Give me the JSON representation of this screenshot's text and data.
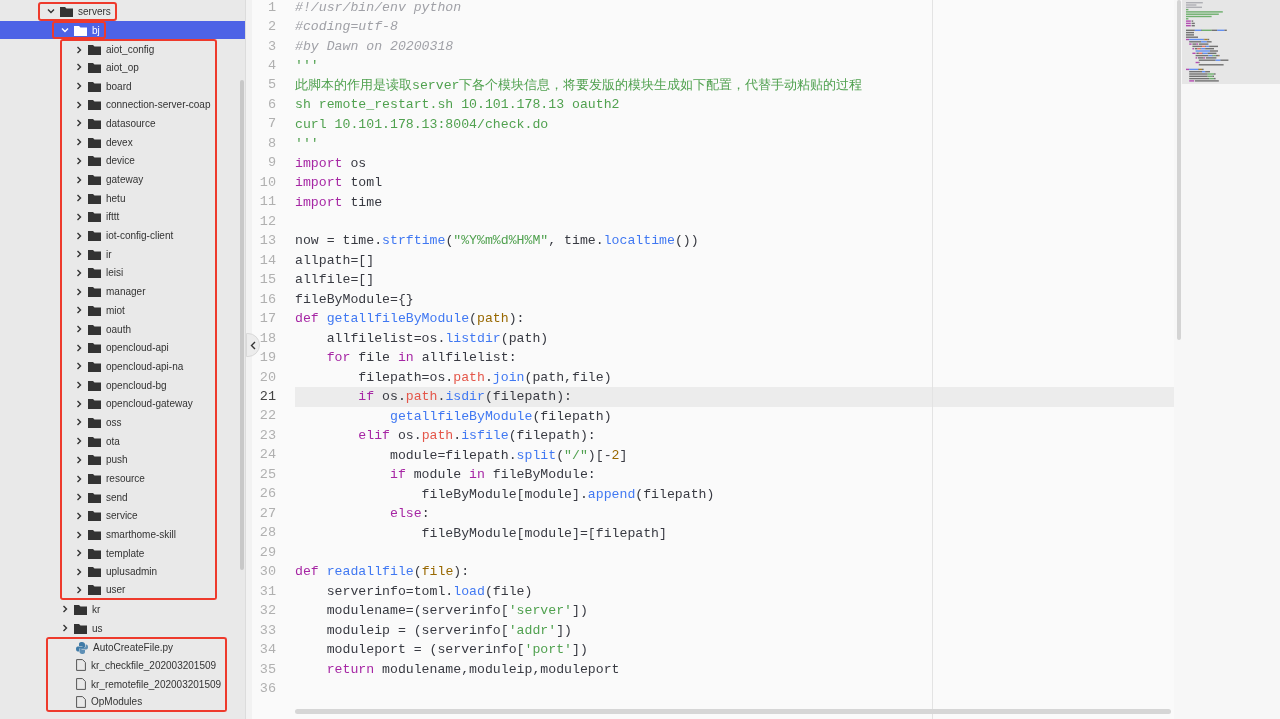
{
  "tree": [
    {
      "name": "servers",
      "kind": "folder",
      "expanded": true,
      "selected": false,
      "annotated": true,
      "children": [
        {
          "name": "bj",
          "kind": "folder",
          "expanded": true,
          "selected": true,
          "annotated": true,
          "children": [
            {
              "name": "aiot_config",
              "kind": "folder",
              "expanded": false,
              "selected": false,
              "annotated": true
            },
            {
              "name": "aiot_op",
              "kind": "folder",
              "expanded": false,
              "selected": false,
              "annotated": true
            },
            {
              "name": "board",
              "kind": "folder",
              "expanded": false,
              "selected": false,
              "annotated": true
            },
            {
              "name": "connection-server-coap",
              "kind": "folder",
              "expanded": false,
              "selected": false,
              "annotated": true
            },
            {
              "name": "datasource",
              "kind": "folder",
              "expanded": false,
              "selected": false,
              "annotated": true
            },
            {
              "name": "devex",
              "kind": "folder",
              "expanded": false,
              "selected": false,
              "annotated": true
            },
            {
              "name": "device",
              "kind": "folder",
              "expanded": false,
              "selected": false,
              "annotated": true
            },
            {
              "name": "gateway",
              "kind": "folder",
              "expanded": false,
              "selected": false,
              "annotated": true
            },
            {
              "name": "hetu",
              "kind": "folder",
              "expanded": false,
              "selected": false,
              "annotated": true
            },
            {
              "name": "ifttt",
              "kind": "folder",
              "expanded": false,
              "selected": false,
              "annotated": true
            },
            {
              "name": "iot-config-client",
              "kind": "folder",
              "expanded": false,
              "selected": false,
              "annotated": true
            },
            {
              "name": "ir",
              "kind": "folder",
              "expanded": false,
              "selected": false,
              "annotated": true
            },
            {
              "name": "leisi",
              "kind": "folder",
              "expanded": false,
              "selected": false,
              "annotated": true
            },
            {
              "name": "manager",
              "kind": "folder",
              "expanded": false,
              "selected": false,
              "annotated": true
            },
            {
              "name": "miot",
              "kind": "folder",
              "expanded": false,
              "selected": false,
              "annotated": true
            },
            {
              "name": "oauth",
              "kind": "folder",
              "expanded": false,
              "selected": false,
              "annotated": true
            },
            {
              "name": "opencloud-api",
              "kind": "folder",
              "expanded": false,
              "selected": false,
              "annotated": true
            },
            {
              "name": "opencloud-api-na",
              "kind": "folder",
              "expanded": false,
              "selected": false,
              "annotated": true
            },
            {
              "name": "opencloud-bg",
              "kind": "folder",
              "expanded": false,
              "selected": false,
              "annotated": true
            },
            {
              "name": "opencloud-gateway",
              "kind": "folder",
              "expanded": false,
              "selected": false,
              "annotated": true
            },
            {
              "name": "oss",
              "kind": "folder",
              "expanded": false,
              "selected": false,
              "annotated": true
            },
            {
              "name": "ota",
              "kind": "folder",
              "expanded": false,
              "selected": false,
              "annotated": true
            },
            {
              "name": "push",
              "kind": "folder",
              "expanded": false,
              "selected": false,
              "annotated": true
            },
            {
              "name": "resource",
              "kind": "folder",
              "expanded": false,
              "selected": false,
              "annotated": true
            },
            {
              "name": "send",
              "kind": "folder",
              "expanded": false,
              "selected": false,
              "annotated": true
            },
            {
              "name": "service",
              "kind": "folder",
              "expanded": false,
              "selected": false,
              "annotated": true
            },
            {
              "name": "smarthome-skill",
              "kind": "folder",
              "expanded": false,
              "selected": false,
              "annotated": true
            },
            {
              "name": "template",
              "kind": "folder",
              "expanded": false,
              "selected": false,
              "annotated": true
            },
            {
              "name": "uplusadmin",
              "kind": "folder",
              "expanded": false,
              "selected": false,
              "annotated": true
            },
            {
              "name": "user",
              "kind": "folder",
              "expanded": false,
              "selected": false,
              "annotated": true
            }
          ]
        },
        {
          "name": "kr",
          "kind": "folder",
          "expanded": false,
          "selected": false,
          "annotated": false
        },
        {
          "name": "us",
          "kind": "folder",
          "expanded": false,
          "selected": false,
          "annotated": false
        },
        {
          "name": "AutoCreateFile.py",
          "kind": "python",
          "selected": false,
          "annotated": true
        },
        {
          "name": "kr_checkfile_202003201509",
          "kind": "file",
          "selected": false,
          "annotated": true
        },
        {
          "name": "kr_remotefile_202003201509",
          "kind": "file",
          "selected": false,
          "annotated": true
        },
        {
          "name": "OpModules",
          "kind": "file",
          "selected": false,
          "annotated": true
        }
      ]
    }
  ],
  "code": [
    {
      "number": "1",
      "current": false,
      "tokens": [
        {
          "kind": "comment",
          "text": "#!/usr/bin/env python"
        }
      ]
    },
    {
      "number": "2",
      "current": false,
      "tokens": [
        {
          "kind": "comment",
          "text": "#coding=utf-8"
        }
      ]
    },
    {
      "number": "3",
      "current": false,
      "tokens": [
        {
          "kind": "comment",
          "text": "#by Dawn on 20200318"
        }
      ]
    },
    {
      "number": "4",
      "current": false,
      "tokens": [
        {
          "kind": "string",
          "text": "'''"
        }
      ]
    },
    {
      "number": "5",
      "current": false,
      "tokens": [
        {
          "kind": "string",
          "text": "此脚本的作用是读取server下各个模块信息，将要发版的模块生成如下配置，代替手动粘贴的过程"
        }
      ]
    },
    {
      "number": "6",
      "current": false,
      "tokens": [
        {
          "kind": "string",
          "text": "sh remote_restart.sh 10.101.178.13 oauth2"
        }
      ]
    },
    {
      "number": "7",
      "current": false,
      "tokens": [
        {
          "kind": "string",
          "text": "curl 10.101.178.13:8004/check.do"
        }
      ]
    },
    {
      "number": "8",
      "current": false,
      "tokens": [
        {
          "kind": "string",
          "text": "'''"
        }
      ]
    },
    {
      "number": "9",
      "current": false,
      "tokens": [
        {
          "kind": "keyword",
          "text": "import"
        },
        {
          "kind": "plain",
          "text": " os"
        }
      ]
    },
    {
      "number": "10",
      "current": false,
      "tokens": [
        {
          "kind": "keyword",
          "text": "import"
        },
        {
          "kind": "plain",
          "text": " toml"
        }
      ]
    },
    {
      "number": "11",
      "current": false,
      "tokens": [
        {
          "kind": "keyword",
          "text": "import"
        },
        {
          "kind": "plain",
          "text": " time"
        }
      ]
    },
    {
      "number": "12",
      "current": false
    },
    {
      "number": "13",
      "current": false,
      "tokens": [
        {
          "kind": "plain",
          "text": "now = time."
        },
        {
          "kind": "function",
          "text": "strftime"
        },
        {
          "kind": "plain",
          "text": "("
        },
        {
          "kind": "string",
          "text": "\"%Y%m%d%H%M\""
        },
        {
          "kind": "plain",
          "text": ", time."
        },
        {
          "kind": "function",
          "text": "localtime"
        },
        {
          "kind": "plain",
          "text": "())"
        }
      ]
    },
    {
      "number": "14",
      "current": false,
      "tokens": [
        {
          "kind": "plain",
          "text": "allpath=[]"
        }
      ]
    },
    {
      "number": "15",
      "current": false,
      "tokens": [
        {
          "kind": "plain",
          "text": "allfile=[]"
        }
      ]
    },
    {
      "number": "16",
      "current": false,
      "tokens": [
        {
          "kind": "plain",
          "text": "fileByModule={}"
        }
      ]
    },
    {
      "number": "17",
      "current": false,
      "tokens": [
        {
          "kind": "keyword",
          "text": "def "
        },
        {
          "kind": "function",
          "text": "getallfileByModule"
        },
        {
          "kind": "plain",
          "text": "("
        },
        {
          "kind": "param",
          "text": "path"
        },
        {
          "kind": "plain",
          "text": "):"
        }
      ]
    },
    {
      "number": "18",
      "current": false,
      "tokens": [
        {
          "kind": "plain",
          "text": "    allfilelist=os."
        },
        {
          "kind": "function",
          "text": "listdir"
        },
        {
          "kind": "plain",
          "text": "(path)"
        }
      ]
    },
    {
      "number": "19",
      "current": false,
      "tokens": [
        {
          "kind": "keyword",
          "text": "    for"
        },
        {
          "kind": "plain",
          "text": " file "
        },
        {
          "kind": "keyword",
          "text": "in"
        },
        {
          "kind": "plain",
          "text": " allfilelist:"
        }
      ]
    },
    {
      "number": "20",
      "current": false,
      "tokens": [
        {
          "kind": "plain",
          "text": "        filepath=os."
        },
        {
          "kind": "attribute",
          "text": "path"
        },
        {
          "kind": "plain",
          "text": "."
        },
        {
          "kind": "function",
          "text": "join"
        },
        {
          "kind": "plain",
          "text": "(path,file)"
        }
      ]
    },
    {
      "number": "21",
      "current": true,
      "tokens": [
        {
          "kind": "keyword",
          "text": "        if"
        },
        {
          "kind": "plain",
          "text": " os."
        },
        {
          "kind": "attribute",
          "text": "path"
        },
        {
          "kind": "plain",
          "text": "."
        },
        {
          "kind": "function",
          "text": "isdir"
        },
        {
          "kind": "plain",
          "text": "(filepath):"
        }
      ]
    },
    {
      "number": "22",
      "current": false,
      "tokens": [
        {
          "kind": "function",
          "text": "            getallfileByModule"
        },
        {
          "kind": "plain",
          "text": "(filepath)"
        }
      ]
    },
    {
      "number": "23",
      "current": false,
      "tokens": [
        {
          "kind": "keyword",
          "text": "        elif"
        },
        {
          "kind": "plain",
          "text": " os."
        },
        {
          "kind": "attribute",
          "text": "path"
        },
        {
          "kind": "plain",
          "text": "."
        },
        {
          "kind": "function",
          "text": "isfile"
        },
        {
          "kind": "plain",
          "text": "(filepath):"
        }
      ]
    },
    {
      "number": "24",
      "current": false,
      "tokens": [
        {
          "kind": "plain",
          "text": "            module=filepath."
        },
        {
          "kind": "function",
          "text": "split"
        },
        {
          "kind": "plain",
          "text": "("
        },
        {
          "kind": "string",
          "text": "\"/\""
        },
        {
          "kind": "plain",
          "text": ")[-"
        },
        {
          "kind": "number",
          "text": "2"
        },
        {
          "kind": "plain",
          "text": "]"
        }
      ]
    },
    {
      "number": "25",
      "current": false,
      "tokens": [
        {
          "kind": "keyword",
          "text": "            if"
        },
        {
          "kind": "plain",
          "text": " module "
        },
        {
          "kind": "keyword",
          "text": "in"
        },
        {
          "kind": "plain",
          "text": " fileByModule:"
        }
      ]
    },
    {
      "number": "26",
      "current": false,
      "tokens": [
        {
          "kind": "plain",
          "text": "                fileByModule[module]."
        },
        {
          "kind": "function",
          "text": "append"
        },
        {
          "kind": "plain",
          "text": "(filepath)"
        }
      ]
    },
    {
      "number": "27",
      "current": false,
      "tokens": [
        {
          "kind": "keyword",
          "text": "            else"
        },
        {
          "kind": "plain",
          "text": ":"
        }
      ]
    },
    {
      "number": "28",
      "current": false,
      "tokens": [
        {
          "kind": "plain",
          "text": "                fileByModule[module]=[filepath]"
        }
      ]
    },
    {
      "number": "29",
      "current": false
    },
    {
      "number": "30",
      "current": false,
      "tokens": [
        {
          "kind": "keyword",
          "text": "def "
        },
        {
          "kind": "function",
          "text": "readallfile"
        },
        {
          "kind": "plain",
          "text": "("
        },
        {
          "kind": "param",
          "text": "file"
        },
        {
          "kind": "plain",
          "text": "):"
        }
      ]
    },
    {
      "number": "31",
      "current": false,
      "tokens": [
        {
          "kind": "plain",
          "text": "    serverinfo=toml."
        },
        {
          "kind": "function",
          "text": "load"
        },
        {
          "kind": "plain",
          "text": "(file)"
        }
      ]
    },
    {
      "number": "32",
      "current": false,
      "tokens": [
        {
          "kind": "plain",
          "text": "    modulename=(serverinfo["
        },
        {
          "kind": "string",
          "text": "'server'"
        },
        {
          "kind": "plain",
          "text": "])"
        }
      ]
    },
    {
      "number": "33",
      "current": false,
      "tokens": [
        {
          "kind": "plain",
          "text": "    moduleip = (serverinfo["
        },
        {
          "kind": "string",
          "text": "'addr'"
        },
        {
          "kind": "plain",
          "text": "])"
        }
      ]
    },
    {
      "number": "34",
      "current": false,
      "tokens": [
        {
          "kind": "plain",
          "text": "    moduleport = (serverinfo["
        },
        {
          "kind": "string",
          "text": "'port'"
        },
        {
          "kind": "plain",
          "text": "])"
        }
      ]
    },
    {
      "number": "35",
      "current": false,
      "tokens": [
        {
          "kind": "keyword",
          "text": "    return"
        },
        {
          "kind": "plain",
          "text": " modulename,moduleip,moduleport"
        }
      ]
    },
    {
      "number": "36",
      "current": false
    }
  ]
}
